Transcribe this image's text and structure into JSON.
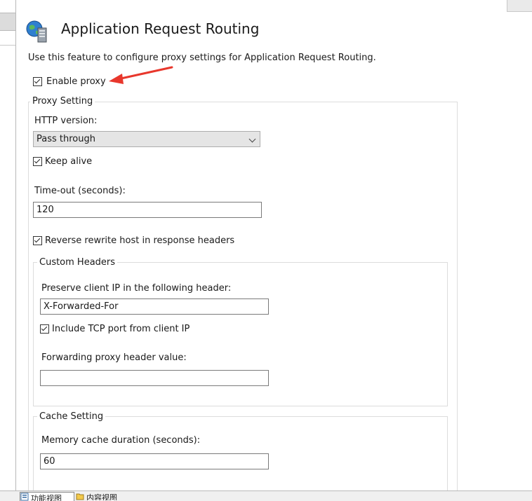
{
  "header": {
    "title": "Application Request Routing",
    "icon": "globe-server-icon"
  },
  "description": "Use this feature to configure proxy settings for Application Request Routing.",
  "enable_proxy": {
    "label": "Enable proxy",
    "checked": true
  },
  "proxy_setting": {
    "legend": "Proxy Setting",
    "http_version_label": "HTTP version:",
    "http_version_value": "Pass through",
    "keep_alive": {
      "label": "Keep alive",
      "checked": true
    },
    "timeout_label": "Time-out (seconds):",
    "timeout_value": "120",
    "reverse_rewrite": {
      "label": "Reverse rewrite host in response headers",
      "checked": true
    }
  },
  "custom_headers": {
    "legend": "Custom Headers",
    "preserve_label": "Preserve client IP in the following header:",
    "preserve_value": "X-Forwarded-For",
    "include_tcp": {
      "label": "Include TCP port from client IP",
      "checked": true
    },
    "forwarding_label": "Forwarding proxy header value:",
    "forwarding_value": ""
  },
  "cache_setting": {
    "legend": "Cache Setting",
    "memory_label": "Memory cache duration (seconds):",
    "memory_value": "60"
  },
  "bottom_tabs": [
    {
      "label": "功能视图",
      "icon": "features-view-icon"
    },
    {
      "label": "内容视图",
      "icon": "content-view-icon"
    }
  ],
  "colors": {
    "arrow": "#e8372c",
    "border": "#dcdcdc"
  }
}
